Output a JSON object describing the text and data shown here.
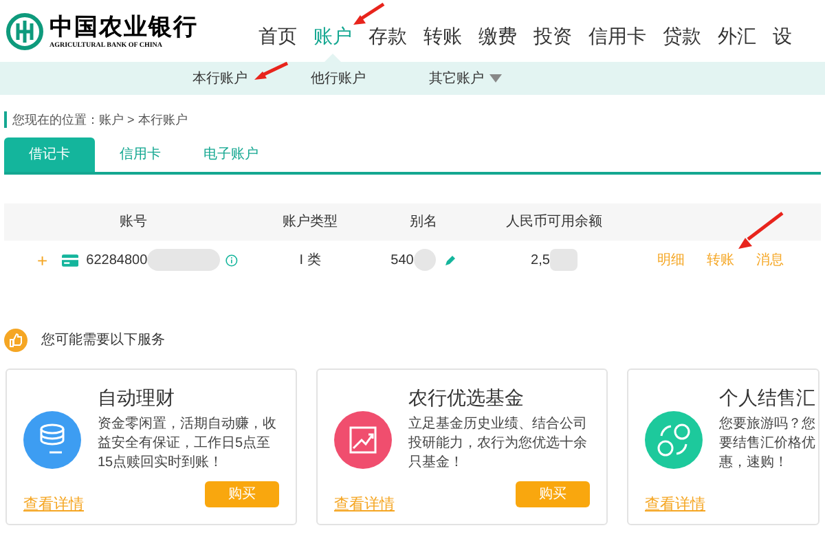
{
  "logo": {
    "name": "中国农业银行",
    "english": "AGRICULTURAL BANK OF CHINA"
  },
  "nav": [
    {
      "label": "首页",
      "selected": false
    },
    {
      "label": "账户",
      "selected": true
    },
    {
      "label": "存款",
      "selected": false
    },
    {
      "label": "转账",
      "selected": false
    },
    {
      "label": "缴费",
      "selected": false
    },
    {
      "label": "投资",
      "selected": false
    },
    {
      "label": "信用卡",
      "selected": false
    },
    {
      "label": "贷款",
      "selected": false
    },
    {
      "label": "外汇",
      "selected": false
    },
    {
      "label": "设",
      "selected": false
    }
  ],
  "subnav": [
    {
      "label": "本行账户",
      "dropdown": false
    },
    {
      "label": "他行账户",
      "dropdown": false
    },
    {
      "label": "其它账户",
      "dropdown": true
    }
  ],
  "breadcrumb": "您现在的位置：账户 > 本行账户",
  "tabs": [
    {
      "label": "借记卡",
      "selected": true
    },
    {
      "label": "信用卡",
      "selected": false
    },
    {
      "label": "电子账户",
      "selected": false
    }
  ],
  "table": {
    "columns": [
      "账号",
      "账户类型",
      "别名",
      "人民币可用余额"
    ],
    "rows": [
      {
        "expand": "+",
        "account": "62284800",
        "type": "I 类",
        "alias": "540",
        "balance": "2,5",
        "actions": [
          "明细",
          "转账",
          "消息"
        ]
      }
    ]
  },
  "services": {
    "title": "您可能需要以下服务",
    "cards": [
      {
        "kind": "auto",
        "color": "#3d9df2",
        "title": "自动理财",
        "description": "资金零闲置，活期自动赚，收益安全有保证，工作日5点至15点赎回实时到账！",
        "details": "查看详情",
        "buy": "购买"
      },
      {
        "kind": "fund",
        "color": "#f04e6e",
        "title": "农行优选基金",
        "description": "立足基金历史业绩、结合公司投研能力，农行为您优选十余只基金！",
        "details": "查看详情",
        "buy": "购买"
      },
      {
        "kind": "exchange",
        "color": "#1dc99c",
        "title": "个人结售汇",
        "description": "您要旅游吗？您要结售汇价格优惠，速购！",
        "details": "查看详情"
      }
    ]
  }
}
